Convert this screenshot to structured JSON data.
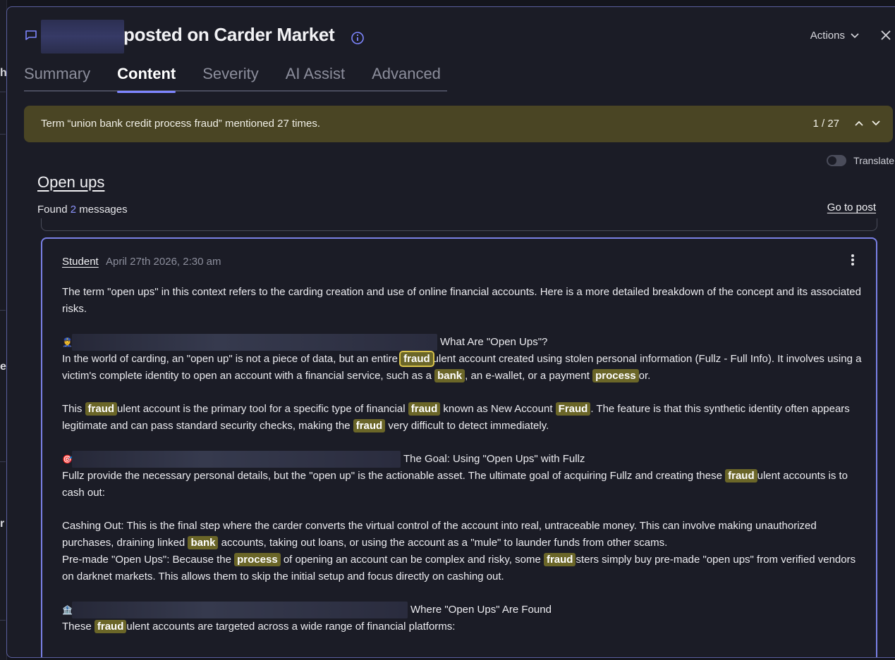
{
  "header": {
    "title": "posted on Carder Market",
    "actions_label": "Actions"
  },
  "tabs": [
    "Summary",
    "Content",
    "Severity",
    "AI Assist",
    "Advanced"
  ],
  "banner": {
    "text": "Term “union bank credit process fraud” mentioned 27 times.",
    "counter": "1 / 27"
  },
  "translate_label": "Translate",
  "section": {
    "title": "Open ups",
    "found_prefix": "Found",
    "found_count": "2",
    "found_suffix": "messages",
    "goto_label": "Go to post"
  },
  "message": {
    "author": "Student",
    "date": "April 27th 2026, 2:30 am",
    "p1": "The term \"open ups\" in this context refers to the carding creation and use of online financial accounts. Here is a more detailed breakdown of the concept and its associated risks.",
    "h1": "What Are \"Open Ups\"?",
    "p2a": "In the world of carding, an \"open up\" is not a piece of data, but an entire",
    "p2b": "ulent account created using stolen personal information (Fullz - Full Info). It involves using a victim's complete identity to open an account with a financial service, such as a",
    "p2c": ", an e-wallet, or a payment",
    "p2d": "or.",
    "p3a": "This",
    "p3b": "ulent account is the primary tool for a specific type of financial",
    "p3c": "known as New Account",
    "p3d": ". The feature is that this synthetic identity often appears legitimate and can pass standard security checks, making the",
    "p3e": "very difficult to detect immediately.",
    "h2": "The Goal: Using \"Open Ups\" with Fullz",
    "p4a": "Fullz provide the necessary personal details, but the \"open up\" is the actionable asset. The ultimate goal of acquiring Fullz and creating these",
    "p4b": "ulent accounts is to cash out:",
    "p5a": "Cashing Out: This is the final step where the carder converts the virtual control of the account into real, untraceable money. This can involve making unauthorized purchases, draining linked",
    "p5b": "accounts, taking out loans, or using the account as a \"mule\" to launder funds from other scams.",
    "p6a": "Pre-made \"Open Ups\": Because the",
    "p6b": "of opening an account can be complex and risky, some",
    "p6c": "sters simply buy pre-made \"open ups\" from verified vendors on darknet markets. This allows them to skip the initial setup and focus directly on cashing out.",
    "h3": "Where \"Open Ups\" Are Found",
    "p7a": "These",
    "p7b": "ulent accounts are targeted across a wide range of financial platforms:",
    "hl_fraud": "fraud",
    "hl_Fraud": "Fraud",
    "hl_bank": "bank",
    "hl_process": "process"
  },
  "colors": {
    "accent": "#7e86ff",
    "highlight_bg": "#6b6628",
    "banner_bg": "#4a4524",
    "panel_border": "#5a5f9e"
  }
}
